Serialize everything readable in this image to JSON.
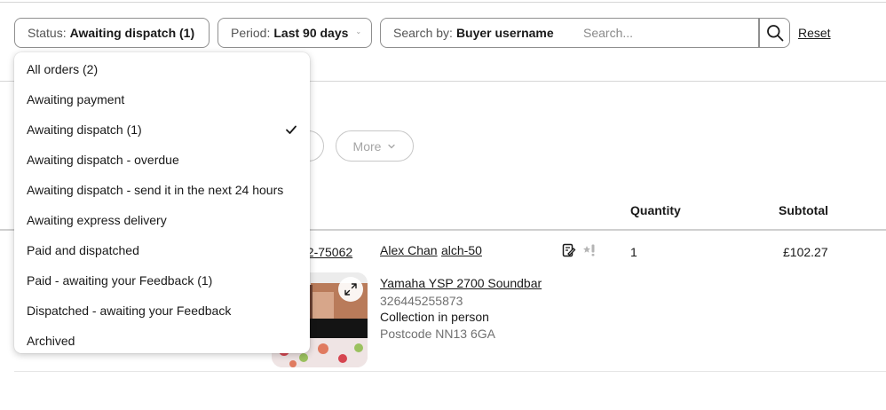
{
  "filters": {
    "status": {
      "label": "Status:",
      "value": "Awaiting dispatch (1)"
    },
    "period": {
      "label": "Period:",
      "value": "Last 90 days"
    },
    "search_by": {
      "label": "Search by:",
      "value": "Buyer username"
    },
    "search_placeholder": "Search...",
    "reset_label": "Reset"
  },
  "pills": {
    "more_label": "More"
  },
  "table": {
    "headers": {
      "quantity": "Quantity",
      "subtotal": "Subtotal"
    },
    "row": {
      "order_number_partial": "52-75062",
      "buyer_name": "Alex Chan",
      "buyer_username": "alch-50",
      "quantity": "1",
      "subtotal": "£102.27",
      "item_title": "Yamaha YSP 2700 Soundbar",
      "item_number": "326445255873",
      "delivery_method": "Collection in person",
      "postcode": "Postcode NN13 6GA"
    }
  },
  "status_dropdown": {
    "selected_index": 2,
    "items": [
      "All orders (2)",
      "Awaiting payment",
      "Awaiting dispatch (1)",
      "Awaiting dispatch - overdue",
      "Awaiting dispatch - send it in the next 24 hours",
      "Awaiting express delivery",
      "Paid and dispatched",
      "Paid - awaiting your Feedback (1)",
      "Dispatched - awaiting your Feedback",
      "Archived"
    ]
  },
  "icons": {
    "chevron": "chevron-down-icon",
    "search": "search-icon",
    "check": "checkmark-icon",
    "note": "note-edit-icon",
    "feedback": "feedback-star-icon",
    "expand": "expand-icon"
  },
  "colors": {
    "text": "#191919",
    "muted": "#707070",
    "border": "#8f8f8f",
    "divider": "#d6d6d6"
  }
}
